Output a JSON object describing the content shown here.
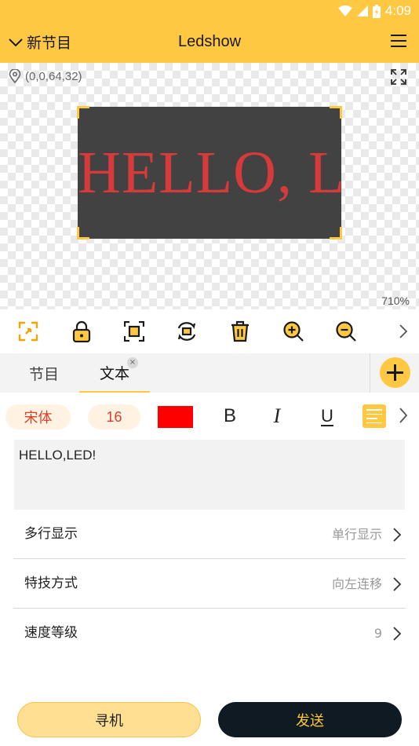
{
  "status_bar": {
    "time": "4:09"
  },
  "app_bar": {
    "program_name": "新节目",
    "title": "Ledshow"
  },
  "canvas": {
    "coordinates": "(0,0,64,32)",
    "preview_text": "HELLO, LE",
    "zoom": "710%",
    "colors": {
      "background": "#424242",
      "text": "#d63a3a",
      "selection": "#FFC843"
    }
  },
  "toolbar": {
    "tools": [
      "expand-icon",
      "lock-icon",
      "fit-frame-icon",
      "rotate-icon",
      "delete-icon",
      "zoom-in-icon",
      "zoom-out-icon",
      "chevron-right-icon"
    ]
  },
  "tabs": {
    "program_label": "节目",
    "text_label": "文本"
  },
  "format": {
    "font": "宋体",
    "size": "16",
    "color": "#ff0000",
    "bold": "B",
    "italic": "I",
    "underline": "U"
  },
  "text_content": "HELLO,LED!",
  "settings": [
    {
      "label": "多行显示",
      "value": "单行显示"
    },
    {
      "label": "特技方式",
      "value": "向左连移"
    },
    {
      "label": "速度等级",
      "value": "9"
    }
  ],
  "actions": {
    "search_label": "寻机",
    "send_label": "发送"
  },
  "accent_color": "#FFC843"
}
